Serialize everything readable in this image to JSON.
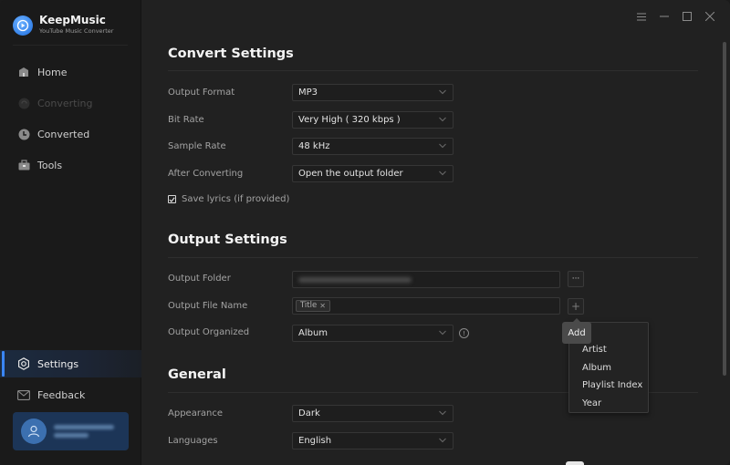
{
  "app": {
    "name": "KeepMusic",
    "subtitle": "YouTube Music Converter"
  },
  "window_controls": [
    "menu-icon",
    "minimize-icon",
    "maximize-icon",
    "close-icon"
  ],
  "sidebar": {
    "items": [
      {
        "label": "Home",
        "icon": "home-icon",
        "state": "normal"
      },
      {
        "label": "Converting",
        "icon": "converting-icon",
        "state": "disabled"
      },
      {
        "label": "Converted",
        "icon": "clock-icon",
        "state": "normal"
      },
      {
        "label": "Tools",
        "icon": "toolbox-icon",
        "state": "normal"
      },
      {
        "label": "Settings",
        "icon": "settings-icon",
        "state": "active"
      },
      {
        "label": "Feedback",
        "icon": "mail-icon",
        "state": "normal"
      }
    ],
    "user": {
      "icon": "user-icon"
    }
  },
  "convert_settings": {
    "title": "Convert Settings",
    "output_format": {
      "label": "Output Format",
      "value": "MP3"
    },
    "bit_rate": {
      "label": "Bit Rate",
      "value": "Very High ( 320 kbps )"
    },
    "sample_rate": {
      "label": "Sample Rate",
      "value": "48 kHz"
    },
    "after_converting": {
      "label": "After Converting",
      "value": "Open the output folder"
    },
    "save_lyrics": {
      "label": "Save lyrics (if provided)",
      "checked": true
    }
  },
  "output_settings": {
    "title": "Output Settings",
    "output_folder": {
      "label": "Output Folder",
      "browse_label": "···"
    },
    "output_file_name": {
      "label": "Output File Name",
      "tags": [
        "Title"
      ],
      "add_label": "+"
    },
    "output_organized": {
      "label": "Output Organized",
      "value": "Album",
      "info_label": "!"
    }
  },
  "add_tooltip": "Add",
  "add_menu": {
    "items": [
      "Artist",
      "Album",
      "Playlist Index",
      "Year"
    ]
  },
  "general": {
    "title": "General",
    "appearance": {
      "label": "Appearance",
      "value": "Dark"
    },
    "languages": {
      "label": "Languages",
      "value": "English"
    }
  },
  "colors": {
    "accent": "#3a86f5",
    "background": "#212121",
    "sidebar": "#1a1a1a",
    "user_card": "#1c3557"
  }
}
